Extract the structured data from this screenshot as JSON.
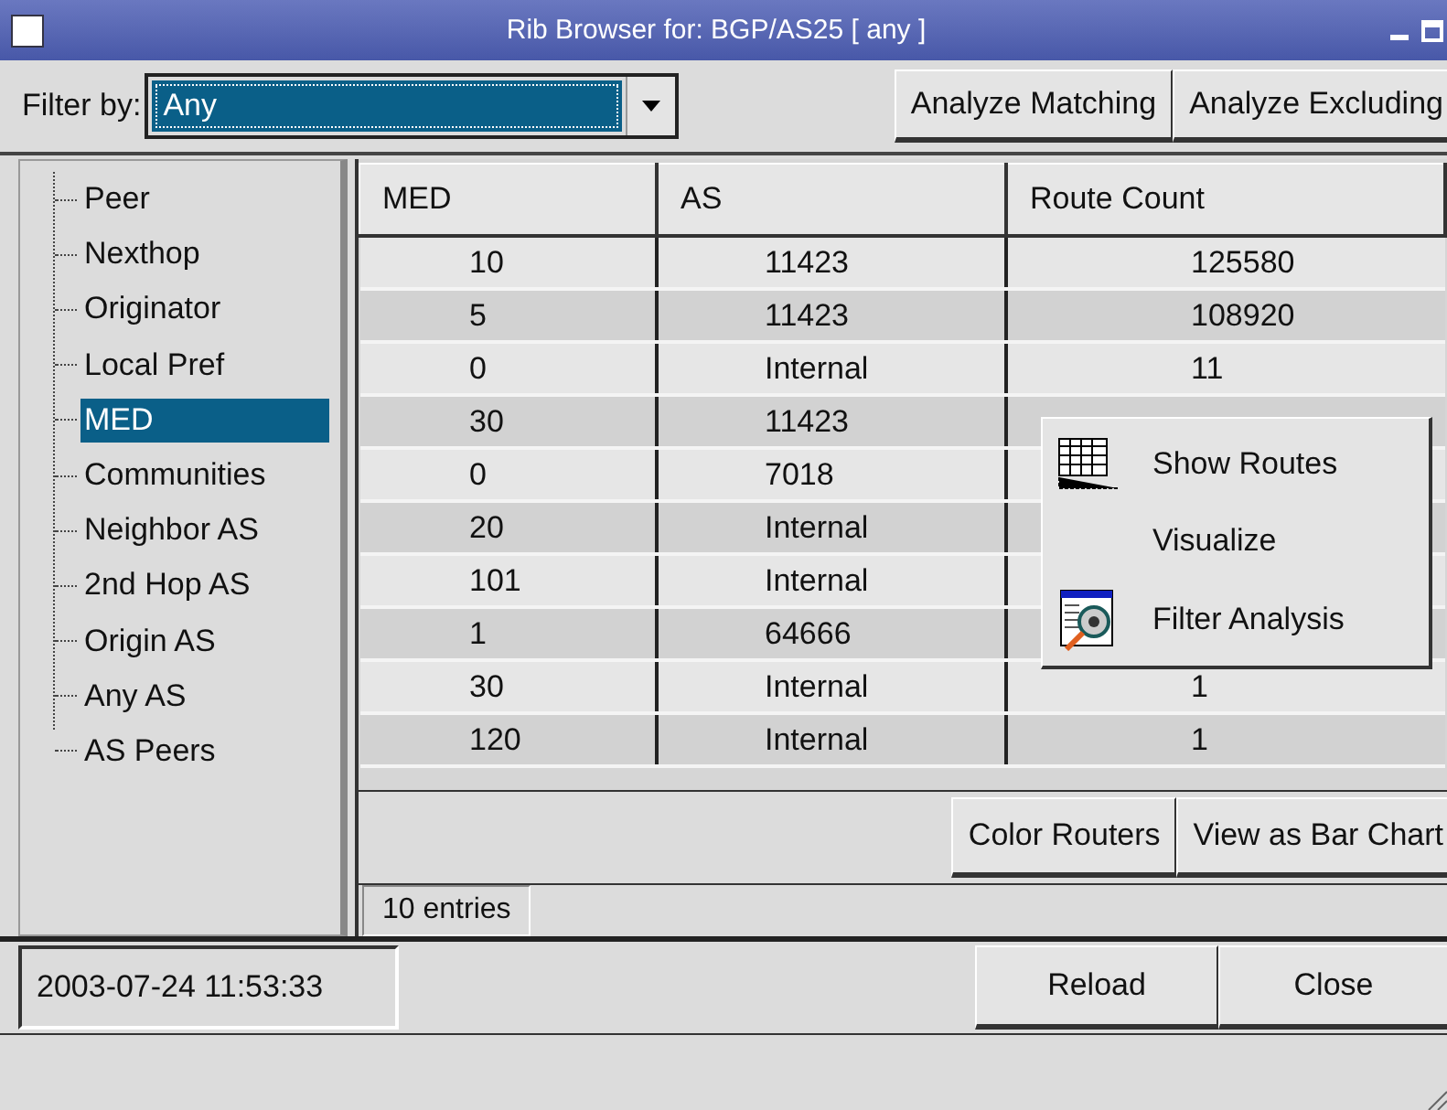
{
  "window": {
    "title": "Rib Browser for: BGP/AS25 [ any ]"
  },
  "filter": {
    "label": "Filter by:",
    "value": "Any"
  },
  "toolbar_buttons": [
    "Analyze Matching",
    "Analyze Excluding"
  ],
  "tree": {
    "items": [
      {
        "label": "Peer",
        "selected": false
      },
      {
        "label": "Nexthop",
        "selected": false
      },
      {
        "label": "Originator",
        "selected": false
      },
      {
        "label": "Local Pref",
        "selected": false
      },
      {
        "label": "MED",
        "selected": true
      },
      {
        "label": "Communities",
        "selected": false
      },
      {
        "label": "Neighbor AS",
        "selected": false
      },
      {
        "label": "2nd Hop AS",
        "selected": false
      },
      {
        "label": "Origin AS",
        "selected": false
      },
      {
        "label": "Any AS",
        "selected": false
      },
      {
        "label": "AS Peers",
        "selected": false
      }
    ]
  },
  "table": {
    "columns": [
      "MED",
      "AS",
      "Route Count"
    ],
    "rows": [
      [
        "10",
        "11423",
        "125580"
      ],
      [
        "5",
        "11423",
        "108920"
      ],
      [
        "0",
        "Internal",
        "11"
      ],
      [
        "30",
        "11423"
      ],
      [
        "0",
        "7018"
      ],
      [
        "20",
        "Internal"
      ],
      [
        "101",
        "Internal"
      ],
      [
        "1",
        "64666"
      ],
      [
        "30",
        "Internal",
        "1"
      ],
      [
        "120",
        "Internal",
        "1"
      ]
    ]
  },
  "context_menu": {
    "items": [
      {
        "label": "Show Routes",
        "kind": "table"
      },
      {
        "label": "Visualize",
        "kind": "none"
      },
      {
        "label": "Filter Analysis",
        "kind": "filter"
      }
    ]
  },
  "actions": [
    "Color Routers",
    "View as Bar Chart"
  ],
  "entry_count": "10 entries",
  "status": {
    "timestamp": "2003-07-24 11:53:33",
    "buttons": [
      "Reload",
      "Close"
    ]
  }
}
